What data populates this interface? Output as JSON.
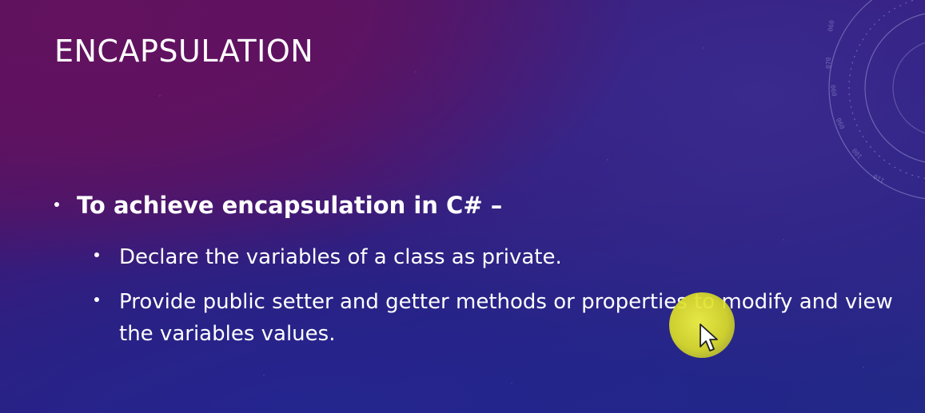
{
  "slide": {
    "title": "ENCAPSULATION",
    "bullet": "To achieve encapsulation in C# –",
    "sub_bullets": [
      "Declare the variables of a class as private.",
      "Provide public setter and getter methods or properties to modify and view the variables values."
    ]
  },
  "colors": {
    "background_top": "#52125e",
    "background_bottom": "#232a86",
    "text": "#ffffff",
    "pointer_highlight": "#e2e33a"
  },
  "icons": {
    "pointer": "mouse-pointer-icon",
    "decoration": "tech-ring-decoration"
  }
}
